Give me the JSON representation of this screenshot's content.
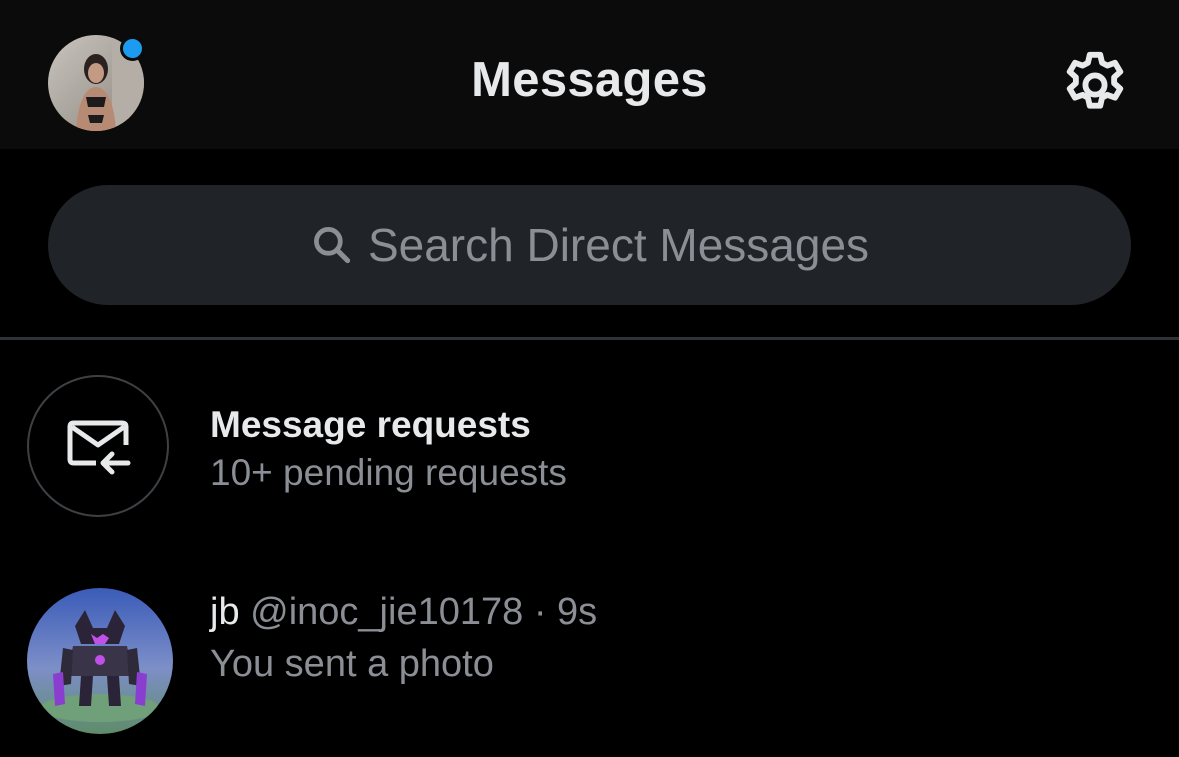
{
  "header": {
    "title": "Messages",
    "avatar_icon": "profile-avatar",
    "settings_icon": "gear-icon",
    "notification_color": "#1d9bf0"
  },
  "search": {
    "placeholder": "Search Direct Messages",
    "icon": "search-icon"
  },
  "message_requests": {
    "icon": "envelope-arrow-icon",
    "title": "Message requests",
    "subtitle": "10+ pending requests"
  },
  "conversations": [
    {
      "name": "jb",
      "handle": "@inoc_jie10178",
      "separator": "·",
      "time": "9s",
      "preview": "You sent a photo"
    }
  ],
  "colors": {
    "background": "#000000",
    "header_background": "#0b0b0b",
    "search_background": "#202327",
    "primary_text": "#e7e9ea",
    "secondary_text": "#8b8f95",
    "accent": "#1d9bf0"
  }
}
